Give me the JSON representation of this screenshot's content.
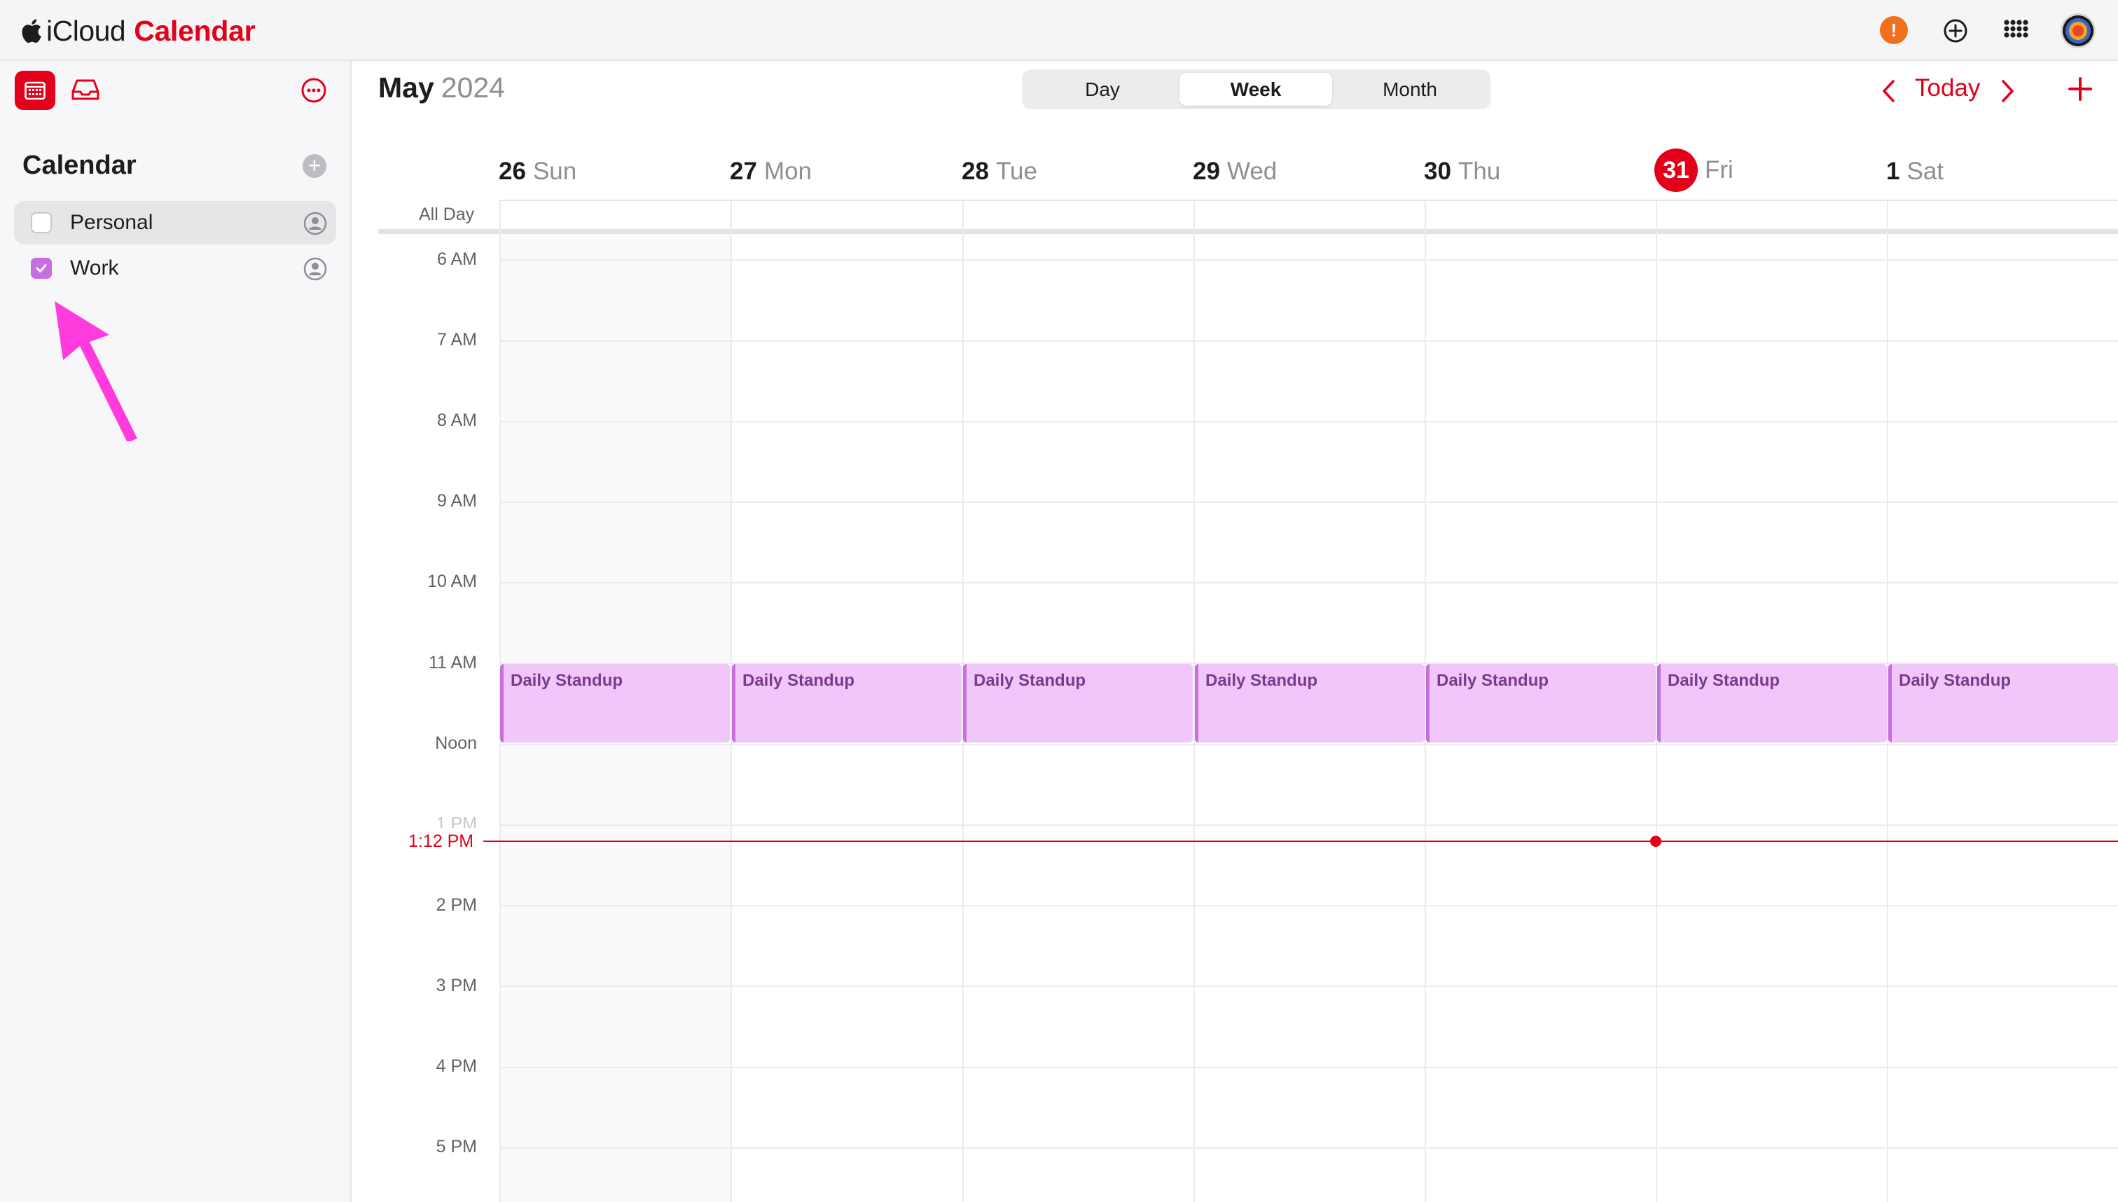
{
  "app": {
    "brand_icloud": "iCloud",
    "brand_app": "Calendar"
  },
  "topbar": {
    "alert_badge": "!",
    "icons": [
      "alert-icon",
      "plus-circle-icon",
      "grid-apps-icon",
      "avatar"
    ]
  },
  "sidebar": {
    "title": "Calendar",
    "add_symbol": "+",
    "calendars": [
      {
        "name": "Personal",
        "checked": false
      },
      {
        "name": "Work",
        "checked": true,
        "color": "#c76fe0"
      }
    ]
  },
  "header": {
    "month": "May",
    "year": "2024",
    "views": [
      "Day",
      "Week",
      "Month"
    ],
    "active_view": "Week",
    "today_label": "Today"
  },
  "week": {
    "days": [
      {
        "num": "26",
        "dow": "Sun"
      },
      {
        "num": "27",
        "dow": "Mon"
      },
      {
        "num": "28",
        "dow": "Tue"
      },
      {
        "num": "29",
        "dow": "Wed"
      },
      {
        "num": "30",
        "dow": "Thu"
      },
      {
        "num": "31",
        "dow": "Fri",
        "today": true
      },
      {
        "num": "1",
        "dow": "Sat"
      }
    ],
    "all_day_label": "All Day",
    "hours": [
      "6 AM",
      "7 AM",
      "8 AM",
      "9 AM",
      "10 AM",
      "11 AM",
      "Noon",
      "1 PM",
      "2 PM",
      "3 PM",
      "4 PM",
      "5 PM"
    ],
    "current_time": "1:12 PM"
  },
  "events": [
    {
      "title": "Daily Standup"
    },
    {
      "title": "Daily Standup"
    },
    {
      "title": "Daily Standup"
    },
    {
      "title": "Daily Standup"
    },
    {
      "title": "Daily Standup"
    },
    {
      "title": "Daily Standup"
    },
    {
      "title": "Daily Standup"
    }
  ],
  "colors": {
    "accent": "#e3001b",
    "work_calendar": "#c76fe0",
    "event_fill": "#f1c6fa",
    "alert_badge": "#f26f1b",
    "annotation_arrow": "#ff3bdd"
  }
}
